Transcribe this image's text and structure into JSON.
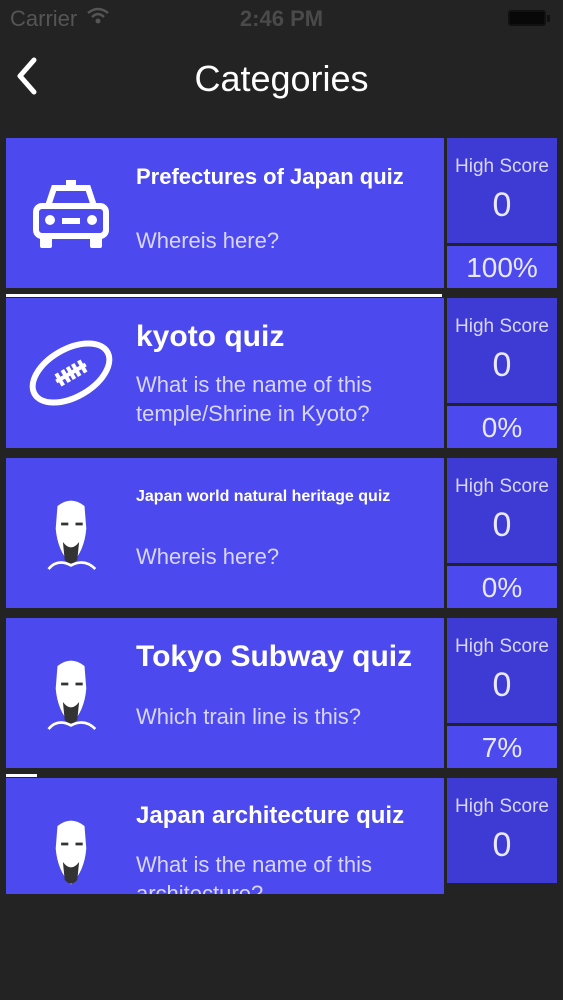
{
  "status_bar": {
    "carrier": "Carrier",
    "time": "2:46 PM"
  },
  "nav": {
    "title": "Categories",
    "back_icon": "chevron-left-icon"
  },
  "colors": {
    "card": "#4c49ee",
    "score_box": "#3e3bd4",
    "background": "#232323"
  },
  "quizzes": [
    {
      "title": "Prefectures of Japan quiz",
      "subtitle": "Whereis here?",
      "icon": "car-icon",
      "high_score_label": "High Score",
      "high_score": "0",
      "percent": "100%",
      "progress": 1.0
    },
    {
      "title": "kyoto quiz",
      "subtitle": "What is the name of this temple/Shrine in Kyoto?",
      "icon": "football-icon",
      "high_score_label": "High Score",
      "high_score": "0",
      "percent": "0%",
      "progress": 0.0
    },
    {
      "title": "Japan world natural heritage quiz",
      "subtitle": "Whereis here?",
      "icon": "portrait-icon",
      "high_score_label": "High Score",
      "high_score": "0",
      "percent": "0%",
      "progress": 0.0
    },
    {
      "title": "Tokyo Subway quiz",
      "subtitle": "Which train line is this?",
      "icon": "portrait-icon",
      "high_score_label": "High Score",
      "high_score": "0",
      "percent": "7%",
      "progress": 0.07
    },
    {
      "title": "Japan architecture quiz",
      "subtitle": "What is the name of this architecture?",
      "icon": "portrait-icon",
      "high_score_label": "High Score",
      "high_score": "0"
    }
  ]
}
